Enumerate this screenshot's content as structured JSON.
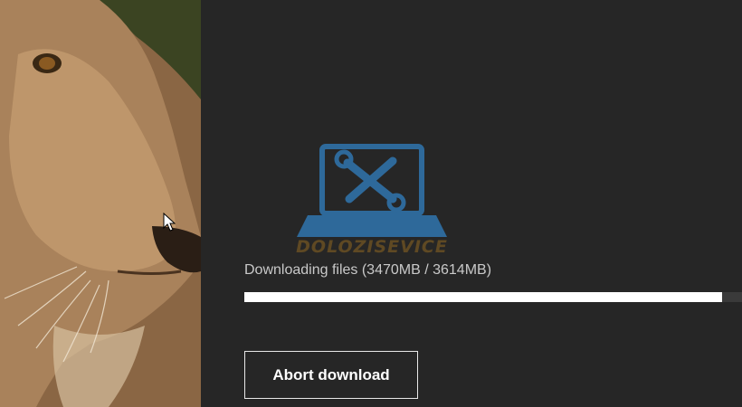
{
  "status": {
    "text": "Downloading files (3470MB / 3614MB)",
    "downloaded_mb": 3470,
    "total_mb": 3614,
    "progress_fraction": 0.96
  },
  "actions": {
    "abort_label": "Abort download"
  },
  "watermark": {
    "text": "DOLOZISEVICE",
    "color_primary": "#2f6fa4",
    "color_text": "#c98a1e"
  },
  "hero": {
    "subject": "lion-face"
  },
  "colors": {
    "background": "#262626",
    "progress_fill": "#ffffff",
    "button_border": "#e8e8e8"
  }
}
